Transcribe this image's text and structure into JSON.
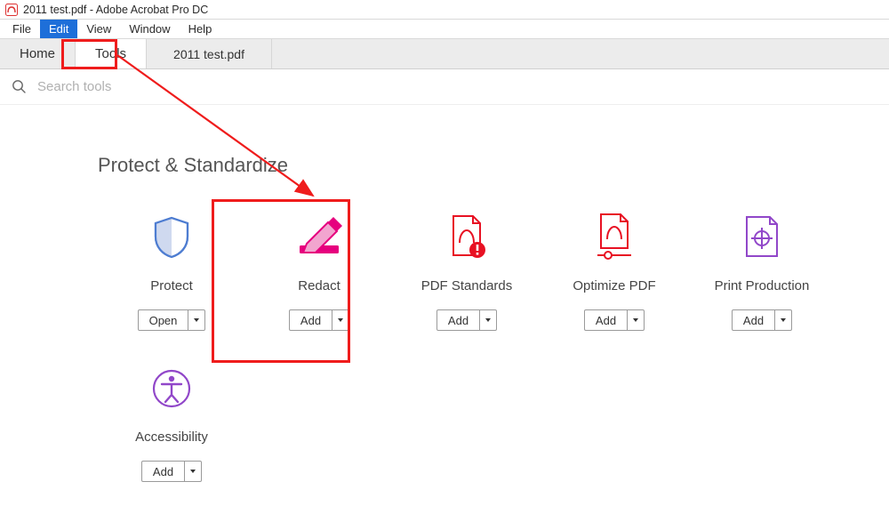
{
  "window": {
    "title": "2011 test.pdf - Adobe Acrobat Pro DC"
  },
  "menu": {
    "file": "File",
    "edit": "Edit",
    "view": "View",
    "window": "Window",
    "help": "Help",
    "selected": "edit"
  },
  "tabs": {
    "home": "Home",
    "tools": "Tools",
    "doc": "2011 test.pdf"
  },
  "search": {
    "placeholder": "Search tools"
  },
  "section": {
    "title": "Protect & Standardize"
  },
  "tools": [
    {
      "id": "protect",
      "label": "Protect",
      "button": "Open",
      "icon": "shield"
    },
    {
      "id": "redact",
      "label": "Redact",
      "button": "Add",
      "icon": "redact"
    },
    {
      "id": "pdf-standards",
      "label": "PDF Standards",
      "button": "Add",
      "icon": "pdf-badge"
    },
    {
      "id": "optimize-pdf",
      "label": "Optimize PDF",
      "button": "Add",
      "icon": "pdf-slider"
    },
    {
      "id": "print-production",
      "label": "Print Production",
      "button": "Add",
      "icon": "register"
    },
    {
      "id": "accessibility",
      "label": "Accessibility",
      "button": "Add",
      "icon": "accessibility"
    }
  ],
  "colors": {
    "highlight": "#ef1c1c",
    "menuSelected": "#1e6fd9",
    "pinkAccent": "#e6007e",
    "redAccent": "#e81123",
    "purpleAccent": "#9147c9",
    "blueAccent": "#4e7dd1"
  }
}
